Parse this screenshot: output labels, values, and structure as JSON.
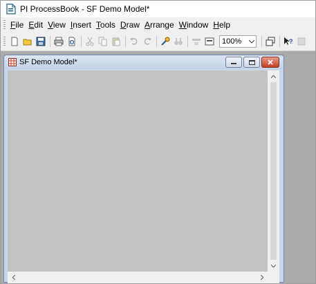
{
  "app": {
    "title": "PI ProcessBook - SF Demo Model*",
    "icon": "processbook-document-icon"
  },
  "menu": [
    {
      "id": "file",
      "pre": "",
      "key": "F",
      "post": "ile"
    },
    {
      "id": "edit",
      "pre": "",
      "key": "E",
      "post": "dit"
    },
    {
      "id": "view",
      "pre": "",
      "key": "V",
      "post": "iew"
    },
    {
      "id": "insert",
      "pre": "",
      "key": "I",
      "post": "nsert"
    },
    {
      "id": "tools",
      "pre": "",
      "key": "T",
      "post": "ools"
    },
    {
      "id": "draw",
      "pre": "",
      "key": "D",
      "post": "raw"
    },
    {
      "id": "arrange",
      "pre": "",
      "key": "A",
      "post": "rrange"
    },
    {
      "id": "window",
      "pre": "",
      "key": "W",
      "post": "indow"
    },
    {
      "id": "help",
      "pre": "",
      "key": "H",
      "post": "elp"
    }
  ],
  "toolbar": {
    "zoom_value": "100%",
    "icons": [
      "new-icon",
      "open-icon",
      "save-icon",
      "print-icon",
      "print-preview-icon",
      "cut-icon",
      "copy-icon",
      "paste-icon",
      "undo-icon",
      "redo-icon",
      "build-mode-icon",
      "binoculars-icon",
      "toolbar-icon-a",
      "toolbar-icon-b",
      "cascade-windows-icon",
      "whats-this-help-icon",
      "toolbar-icon-c"
    ]
  },
  "document": {
    "title": "SF Demo Model*",
    "icon": "display-grid-icon"
  },
  "colors": {
    "canvas": "#c3c3c3",
    "close_button": "#c94a30",
    "mdi_frame": "#c8d6e8"
  }
}
